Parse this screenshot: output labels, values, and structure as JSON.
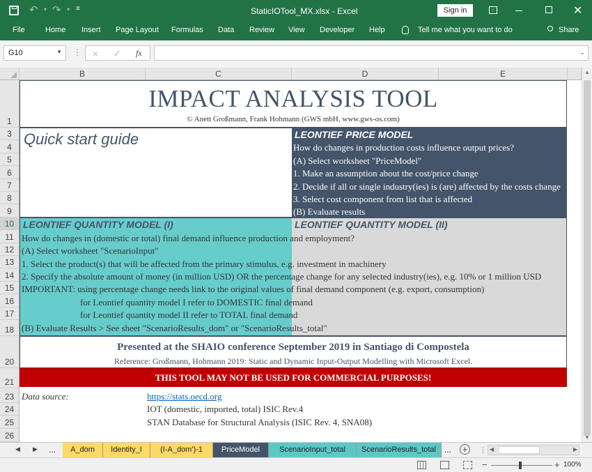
{
  "titlebar": {
    "filename": "StaticIOTool_MX.xlsx",
    "separator": "-",
    "app": "Excel",
    "signin": "Sign in"
  },
  "ribbon": {
    "tabs": [
      "File",
      "Home",
      "Insert",
      "Page Layout",
      "Formulas",
      "Data",
      "Review",
      "View",
      "Developer",
      "Help"
    ],
    "tell_me": "Tell me what you want to do",
    "share": "Share"
  },
  "formula_bar": {
    "name_box": "G10",
    "cancel": "×",
    "enter": "✓",
    "fx": "fx",
    "value": ""
  },
  "columns": [
    "B",
    "C",
    "D",
    "E"
  ],
  "rows": [
    "1",
    "3",
    "4",
    "5",
    "6",
    "7",
    "8",
    "9",
    "10",
    "11",
    "12",
    "13",
    "14",
    "15",
    "16",
    "17",
    "18",
    "20",
    "21",
    "23",
    "24",
    "25",
    "26"
  ],
  "sheet": {
    "title": "IMPACT ANALYSIS TOOL",
    "authors": "© Anett Großmann, Frank Hohmann (GWS mbH, www.gws-os.com)",
    "quick_start": "Quick start guide",
    "price_heading": "LEONTIEF PRICE MODEL",
    "price_lines": [
      "How do changes in production costs influence output prices?",
      "(A) Select worksheet \"PriceModel\"",
      "1. Make an assumption about the cost/price change",
      "2. Decide if all or single industry(ies) is (are) affected by the costs change",
      "3. Select cost component from list that is affected",
      "(B) Evaluate results"
    ],
    "qty1_heading": "LEONTIEF QUANTITY MODEL (I)",
    "qty2_heading": "LEONTIEF QUANTITY MODEL (II)",
    "qty_lines": [
      "How do changes in (domestic or total) final demand influence production and employment?",
      "(A) Select worksheet \"ScenarioInput\"",
      "1. Select the product(s) that will be affected from the primary stimulus, e.g. investment in machinery",
      "2. Specify the absolute amount of money (in million USD) OR the percentage change for any selected industry(ies), e.g. 10% or 1 million USD",
      "IMPORTANT: using percentage change needs link to the original values of final demand component (e.g. export, consumption)",
      "for Leontief quantity model I refer to DOMESTIC final demand",
      "for Leontief quantity model II refer to TOTAL final demand",
      "(B) Evaluate Results > See sheet \"ScenarioResults_dom\" or \"ScenarioResults_total\""
    ],
    "presented": "Presented at the SHAIO conference September 2019 in Santiago di Compostela",
    "reference": "Reference: Großmann, Hohmann 2019: Static and Dynamic Input-Output Modelling with Microsoft Excel.",
    "warning": "THIS TOOL MAY NOT BE USED FOR COMMERCIAL PURPOSES!",
    "data_source_label": "Data source:",
    "data_source_link": "https://stats.oecd.org",
    "data_source_1": "IOT (domestic, imported, total) ISIC Rev.4",
    "data_source_2": "STAN Database for Structural Analysis (ISIC Rev. 4, SNA08)"
  },
  "sheet_tabs": [
    {
      "label": "A_dom",
      "color": "#ffd966"
    },
    {
      "label": "Identity_I",
      "color": "#ffd966"
    },
    {
      "label": "(I-A_dom')-1",
      "color": "#ffd966"
    },
    {
      "label": "PriceModel",
      "color": "#44546a"
    },
    {
      "label": "ScenarioInput_total",
      "color": "#5bc8c6"
    },
    {
      "label": "ScenarioResults_total",
      "color": "#5bc8c6"
    }
  ],
  "tabs_nav": {
    "ellipsis": "...",
    "more": "..."
  },
  "status": {
    "zoom": "100%"
  },
  "colors": {
    "excel_green": "#217346",
    "navy": "#44546a",
    "teal": "#66cdcc",
    "grey": "#d9d9d9",
    "warning_red": "#c00000"
  }
}
